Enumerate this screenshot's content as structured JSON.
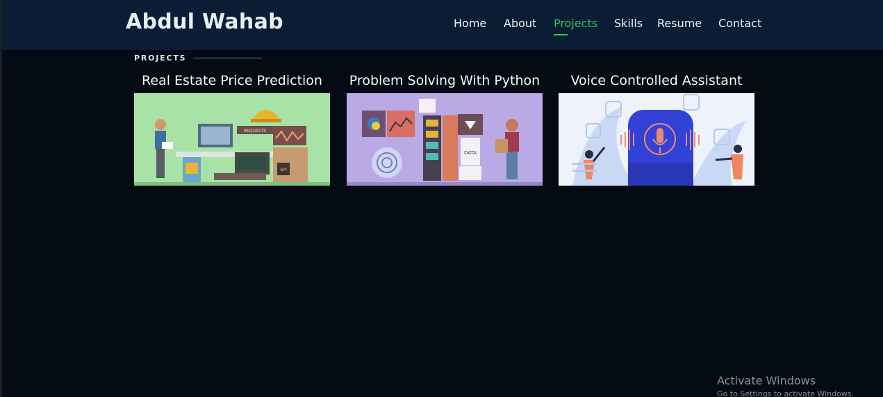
{
  "header": {
    "logo": "Abdul Wahab",
    "nav": [
      {
        "label": "Home",
        "active": false
      },
      {
        "label": "About",
        "active": false
      },
      {
        "label": "Projects",
        "active": true
      },
      {
        "label": "Skills",
        "active": false
      },
      {
        "label": "Resume",
        "active": false
      },
      {
        "label": "Contact",
        "active": false
      }
    ]
  },
  "section": {
    "label": "PROJECTS"
  },
  "projects": [
    {
      "title": "Real Estate Price Prediction",
      "image_icon": "api-machine-illustration",
      "bg": "#a8e2a6"
    },
    {
      "title": "Problem Solving With Python",
      "image_icon": "data-machine-illustration",
      "bg": "#b9a9e4"
    },
    {
      "title": "Voice Controlled Assistant",
      "image_icon": "voice-assistant-illustration",
      "bg": "#eef2fb"
    }
  ],
  "illustration_text": {
    "requests": "REQUESTS",
    "api": "API",
    "data": "DATA"
  },
  "watermark": {
    "title": "Activate Windows",
    "subtitle": "Go to Settings to activate Windows."
  },
  "colors": {
    "header_bg": "#0a1d35",
    "page_bg": "#040b14",
    "accent": "#30c35d"
  }
}
